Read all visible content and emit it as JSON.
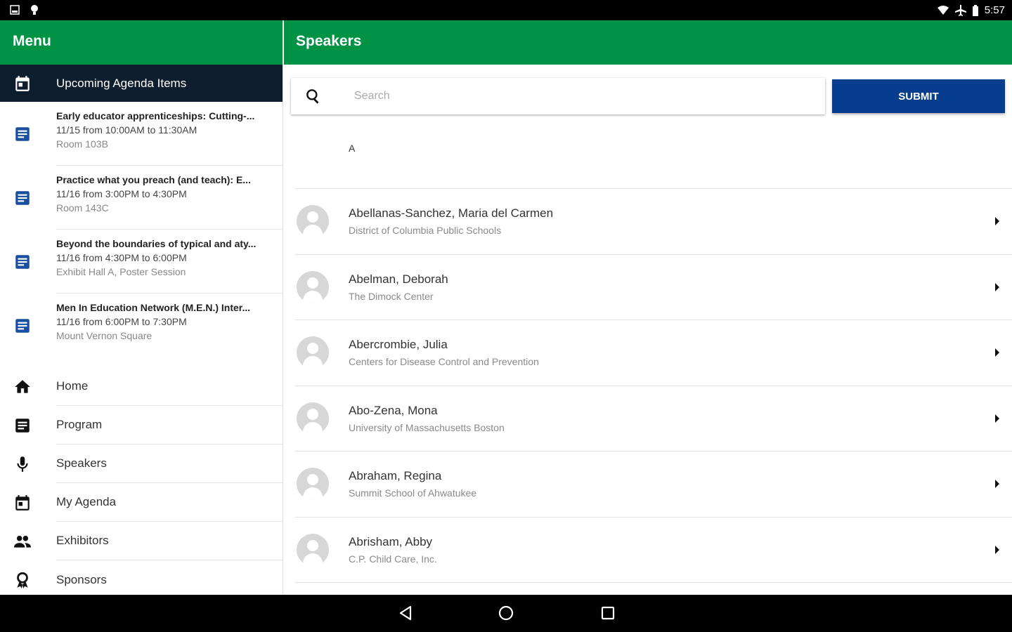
{
  "status_bar": {
    "time": "5:57",
    "left_icons": [
      "gallery-icon",
      "notification-icon"
    ],
    "right_icons": [
      "wifi-icon",
      "airplane-icon",
      "battery-icon"
    ]
  },
  "sidebar": {
    "title": "Menu",
    "upcoming_label": "Upcoming Agenda Items",
    "agenda_items": [
      {
        "title": "Early educator apprenticeships: Cutting-...",
        "time": "11/15 from 10:00AM to 11:30AM",
        "room": "Room 103B"
      },
      {
        "title": "Practice what you preach (and teach): E...",
        "time": "11/16 from 3:00PM to 4:30PM",
        "room": "Room 143C"
      },
      {
        "title": "Beyond the boundaries of typical and aty...",
        "time": "11/16 from 4:30PM to 6:00PM",
        "room": "Exhibit Hall A, Poster Session"
      },
      {
        "title": "Men In Education Network (M.E.N.) Inter...",
        "time": "11/16 from 6:00PM to 7:30PM",
        "room": "Mount Vernon Square"
      }
    ],
    "nav": [
      {
        "label": "Home",
        "icon": "home-icon"
      },
      {
        "label": "Program",
        "icon": "program-icon"
      },
      {
        "label": "Speakers",
        "icon": "microphone-icon"
      },
      {
        "label": "My Agenda",
        "icon": "calendar-icon"
      },
      {
        "label": "Exhibitors",
        "icon": "people-icon"
      },
      {
        "label": "Sponsors",
        "icon": "ribbon-icon"
      }
    ]
  },
  "main": {
    "title": "Speakers",
    "search": {
      "placeholder": "Search",
      "value": ""
    },
    "submit_label": "SUBMIT",
    "section_letter": "A",
    "speakers": [
      {
        "name": "Abellanas-Sanchez, Maria del Carmen",
        "org": "District of Columbia Public Schools"
      },
      {
        "name": "Abelman, Deborah",
        "org": "The Dimock Center"
      },
      {
        "name": "Abercrombie, Julia",
        "org": "Centers for Disease Control and Prevention"
      },
      {
        "name": "Abo-Zena, Mona",
        "org": "University of Massachusetts Boston"
      },
      {
        "name": "Abraham, Regina",
        "org": "Summit School of Ahwatukee"
      },
      {
        "name": "Abrisham, Abby",
        "org": "C.P. Child Care, Inc."
      }
    ]
  },
  "colors": {
    "header_green": "#009345",
    "upcoming_bg": "#0f1e2e",
    "submit_blue": "#063d8c",
    "agenda_icon_blue": "#1a4fa0"
  }
}
